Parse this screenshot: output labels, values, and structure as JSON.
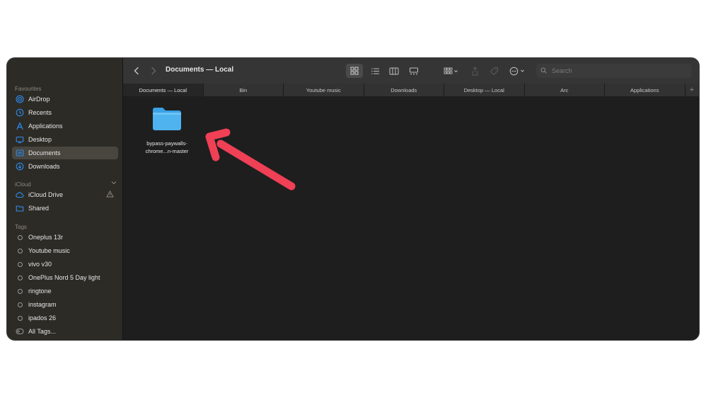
{
  "window": {
    "title": "Documents — Local"
  },
  "sidebar": {
    "favourites_title": "Favourites",
    "favourites": [
      {
        "label": "AirDrop",
        "icon": "airdrop-icon"
      },
      {
        "label": "Recents",
        "icon": "clock-icon"
      },
      {
        "label": "Applications",
        "icon": "applications-icon"
      },
      {
        "label": "Desktop",
        "icon": "desktop-icon"
      },
      {
        "label": "Documents",
        "icon": "document-icon"
      },
      {
        "label": "Downloads",
        "icon": "download-icon"
      }
    ],
    "icloud_title": "iCloud",
    "icloud": [
      {
        "label": "iCloud Drive",
        "icon": "cloud-icon"
      },
      {
        "label": "Shared",
        "icon": "shared-folder-icon"
      }
    ],
    "tags_title": "Tags",
    "tags": [
      {
        "label": "Oneplus 13r"
      },
      {
        "label": "Youtube music"
      },
      {
        "label": "vivo v30"
      },
      {
        "label": "OnePlus Nord 5 Day light"
      },
      {
        "label": "ringtone"
      },
      {
        "label": "instagram"
      },
      {
        "label": "ipados 26"
      },
      {
        "label": "All Tags..."
      }
    ]
  },
  "toolbar": {
    "search_placeholder": "Search"
  },
  "tabs": [
    {
      "label": "Documents — Local"
    },
    {
      "label": "Bin"
    },
    {
      "label": "Youtube music"
    },
    {
      "label": "Downloads"
    },
    {
      "label": "Desktop — Local"
    },
    {
      "label": "Arc"
    },
    {
      "label": "Applications"
    }
  ],
  "files": [
    {
      "line1": "bypass-paywalls-",
      "line2": "chrome...n-master"
    }
  ],
  "colors": {
    "accent": "#2d8cf0",
    "folder": "#4fb3ef",
    "arrow": "#ef4055",
    "sidebar_bg": "#2d2b26",
    "content_bg": "#1e1e1e"
  }
}
